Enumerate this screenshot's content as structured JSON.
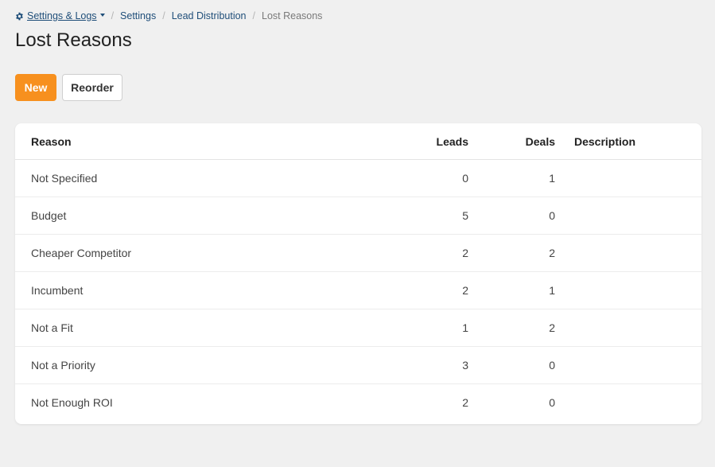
{
  "breadcrumb": {
    "settings_logs": "Settings & Logs",
    "settings": "Settings",
    "lead_distribution": "Lead Distribution",
    "current": "Lost Reasons",
    "separator": "/"
  },
  "page": {
    "title": "Lost Reasons"
  },
  "actions": {
    "new_label": "New",
    "reorder_label": "Reorder"
  },
  "colors": {
    "accent": "#f7901e",
    "link": "#1f4e79",
    "background": "#f0f0f0"
  },
  "table": {
    "columns": {
      "reason": "Reason",
      "leads": "Leads",
      "deals": "Deals",
      "description": "Description"
    },
    "rows": [
      {
        "reason": "Not Specified",
        "leads": "0",
        "deals": "1",
        "description": ""
      },
      {
        "reason": "Budget",
        "leads": "5",
        "deals": "0",
        "description": ""
      },
      {
        "reason": "Cheaper Competitor",
        "leads": "2",
        "deals": "2",
        "description": ""
      },
      {
        "reason": "Incumbent",
        "leads": "2",
        "deals": "1",
        "description": ""
      },
      {
        "reason": "Not a Fit",
        "leads": "1",
        "deals": "2",
        "description": ""
      },
      {
        "reason": "Not a Priority",
        "leads": "3",
        "deals": "0",
        "description": ""
      },
      {
        "reason": "Not Enough ROI",
        "leads": "2",
        "deals": "0",
        "description": ""
      }
    ]
  }
}
